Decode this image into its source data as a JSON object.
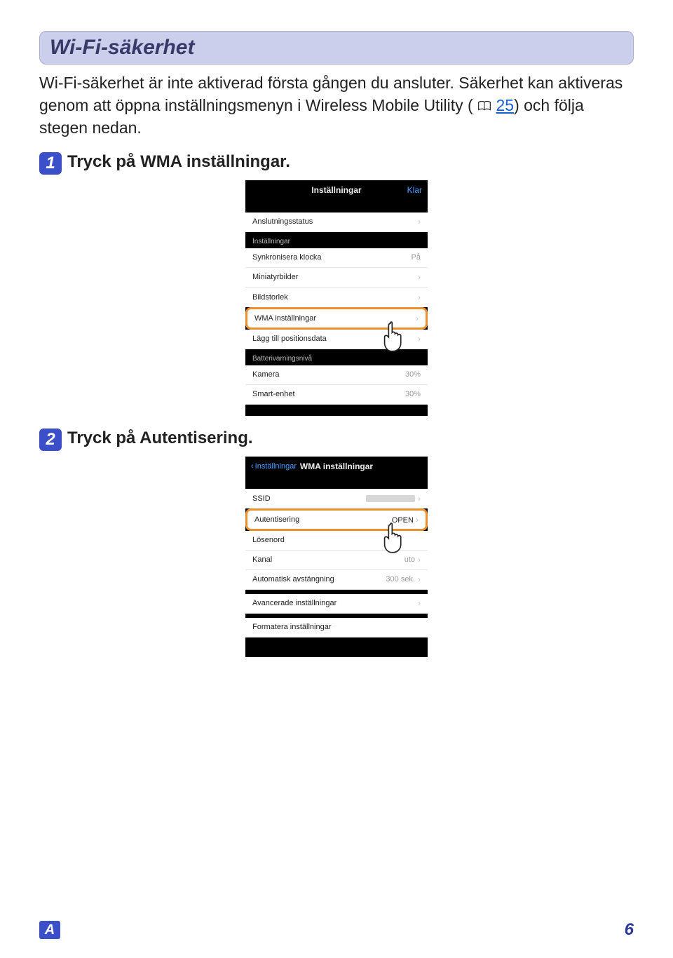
{
  "section_title": "Wi-Fi-säkerhet",
  "body": {
    "p1": "Wi-Fi-säkerhet är inte aktiverad första gången du ansluter. Säkerhet kan aktiveras genom att öppna inställningsmenyn i Wireless Mobile Utility (",
    "page_ref": "25",
    "p1_after": ") och följa stegen nedan."
  },
  "steps": {
    "1": {
      "num": "1",
      "prefix": "Tryck på ",
      "bold": "WMA inställningar",
      "suffix": "."
    },
    "2": {
      "num": "2",
      "prefix": "Tryck på ",
      "bold": "Autentisering",
      "suffix": "."
    }
  },
  "phone1": {
    "nav_title": "Inställningar",
    "nav_right": "Klar",
    "status_row": "Anslutningsstatus",
    "group_label": "Inställningar",
    "rows": {
      "sync": {
        "label": "Synkronisera klocka",
        "value": "På"
      },
      "thumb": {
        "label": "Miniatyrbilder"
      },
      "size": {
        "label": "Bildstorlek"
      },
      "wma": {
        "label": "WMA inställningar"
      },
      "pos": {
        "label": "Lägg till positionsdata"
      }
    },
    "batt_label": "Batterivarningsnivå",
    "batt": {
      "camera": {
        "label": "Kamera",
        "value": "30%"
      },
      "device": {
        "label": "Smart-enhet",
        "value": "30%"
      }
    }
  },
  "phone2": {
    "nav_back": "Inställningar",
    "nav_title": "WMA inställningar",
    "rows": {
      "ssid": {
        "label": "SSID"
      },
      "auth": {
        "label": "Autentisering",
        "value": "OPEN"
      },
      "pass": {
        "label": "Lösenord"
      },
      "chan": {
        "label": "Kanal",
        "value": "uto"
      },
      "auto": {
        "label": "Automatisk avstängning",
        "value": "300 sek."
      },
      "adv": {
        "label": "Avancerade inställningar"
      },
      "fmt": {
        "label": "Formatera inställningar"
      }
    }
  },
  "footer": {
    "letter": "A",
    "page": "6"
  }
}
